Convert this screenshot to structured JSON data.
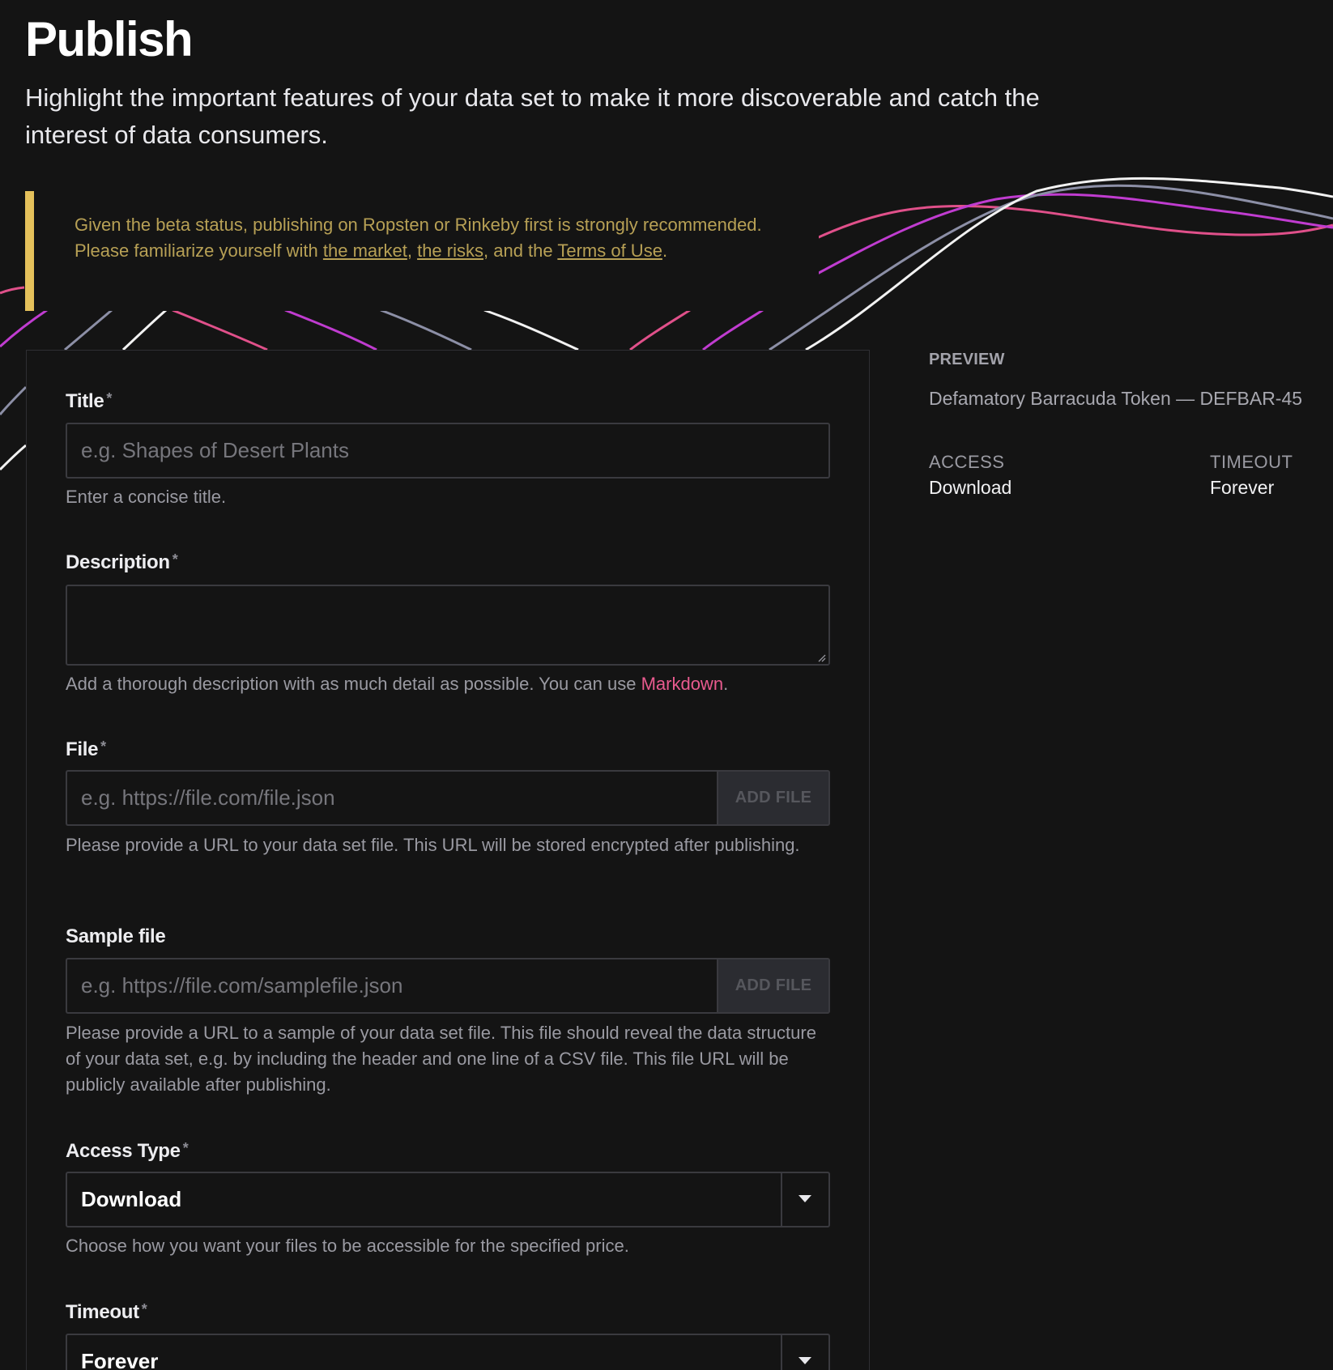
{
  "header": {
    "title": "Publish",
    "subtitle": "Highlight the important features of your data set to make it more discoverable and catch the interest of data consumers."
  },
  "alert": {
    "text_before": "Given the beta status, publishing on Ropsten or Rinkeby first is strongly recommended. Please familiarize yourself with ",
    "link_market": "the market",
    "separator": ", ",
    "link_risks": "the risks",
    "text_middle": ", and the ",
    "link_terms": "Terms of Use",
    "text_after": ".",
    "accent_color": "#e5c15b"
  },
  "form": {
    "required_marker": "*",
    "title": {
      "label": "Title",
      "placeholder": "e.g. Shapes of Desert Plants",
      "value": "",
      "help": "Enter a concise title."
    },
    "description": {
      "label": "Description",
      "value": "",
      "help_before": "Add a thorough description with as much detail as possible. You can use ",
      "help_link": "Markdown",
      "help_after": "."
    },
    "file": {
      "label": "File",
      "placeholder": "e.g. https://file.com/file.json",
      "value": "",
      "button": "ADD FILE",
      "help": "Please provide a URL to your data set file. This URL will be stored encrypted after publishing."
    },
    "sample_file": {
      "label": "Sample file",
      "placeholder": "e.g. https://file.com/samplefile.json",
      "value": "",
      "button": "ADD FILE",
      "help": "Please provide a URL to a sample of your data set file. This file should reveal the data structure of your data set, e.g. by including the header and one line of a CSV file. This file URL will be publicly available after publishing."
    },
    "access_type": {
      "label": "Access Type",
      "selected": "Download",
      "help": "Choose how you want your files to be accessible for the specified price."
    },
    "timeout": {
      "label": "Timeout",
      "selected": "Forever"
    }
  },
  "preview": {
    "heading": "PREVIEW",
    "token": "Defamatory Barracuda Token — DEFBAR-45",
    "access_label": "ACCESS",
    "access_value": "Download",
    "timeout_label": "TIMEOUT",
    "timeout_value": "Forever"
  },
  "colors": {
    "background": "#141414",
    "alert_text": "#b7a055",
    "link_pink": "#e85a8e",
    "wave_pink": "#e0508a",
    "wave_magenta": "#c03cd0",
    "wave_gray": "#8c8fa6",
    "wave_white": "#f2f2f2"
  },
  "icons": {
    "select_arrow": "caret-down-icon",
    "resize": "resize-handle-icon"
  }
}
